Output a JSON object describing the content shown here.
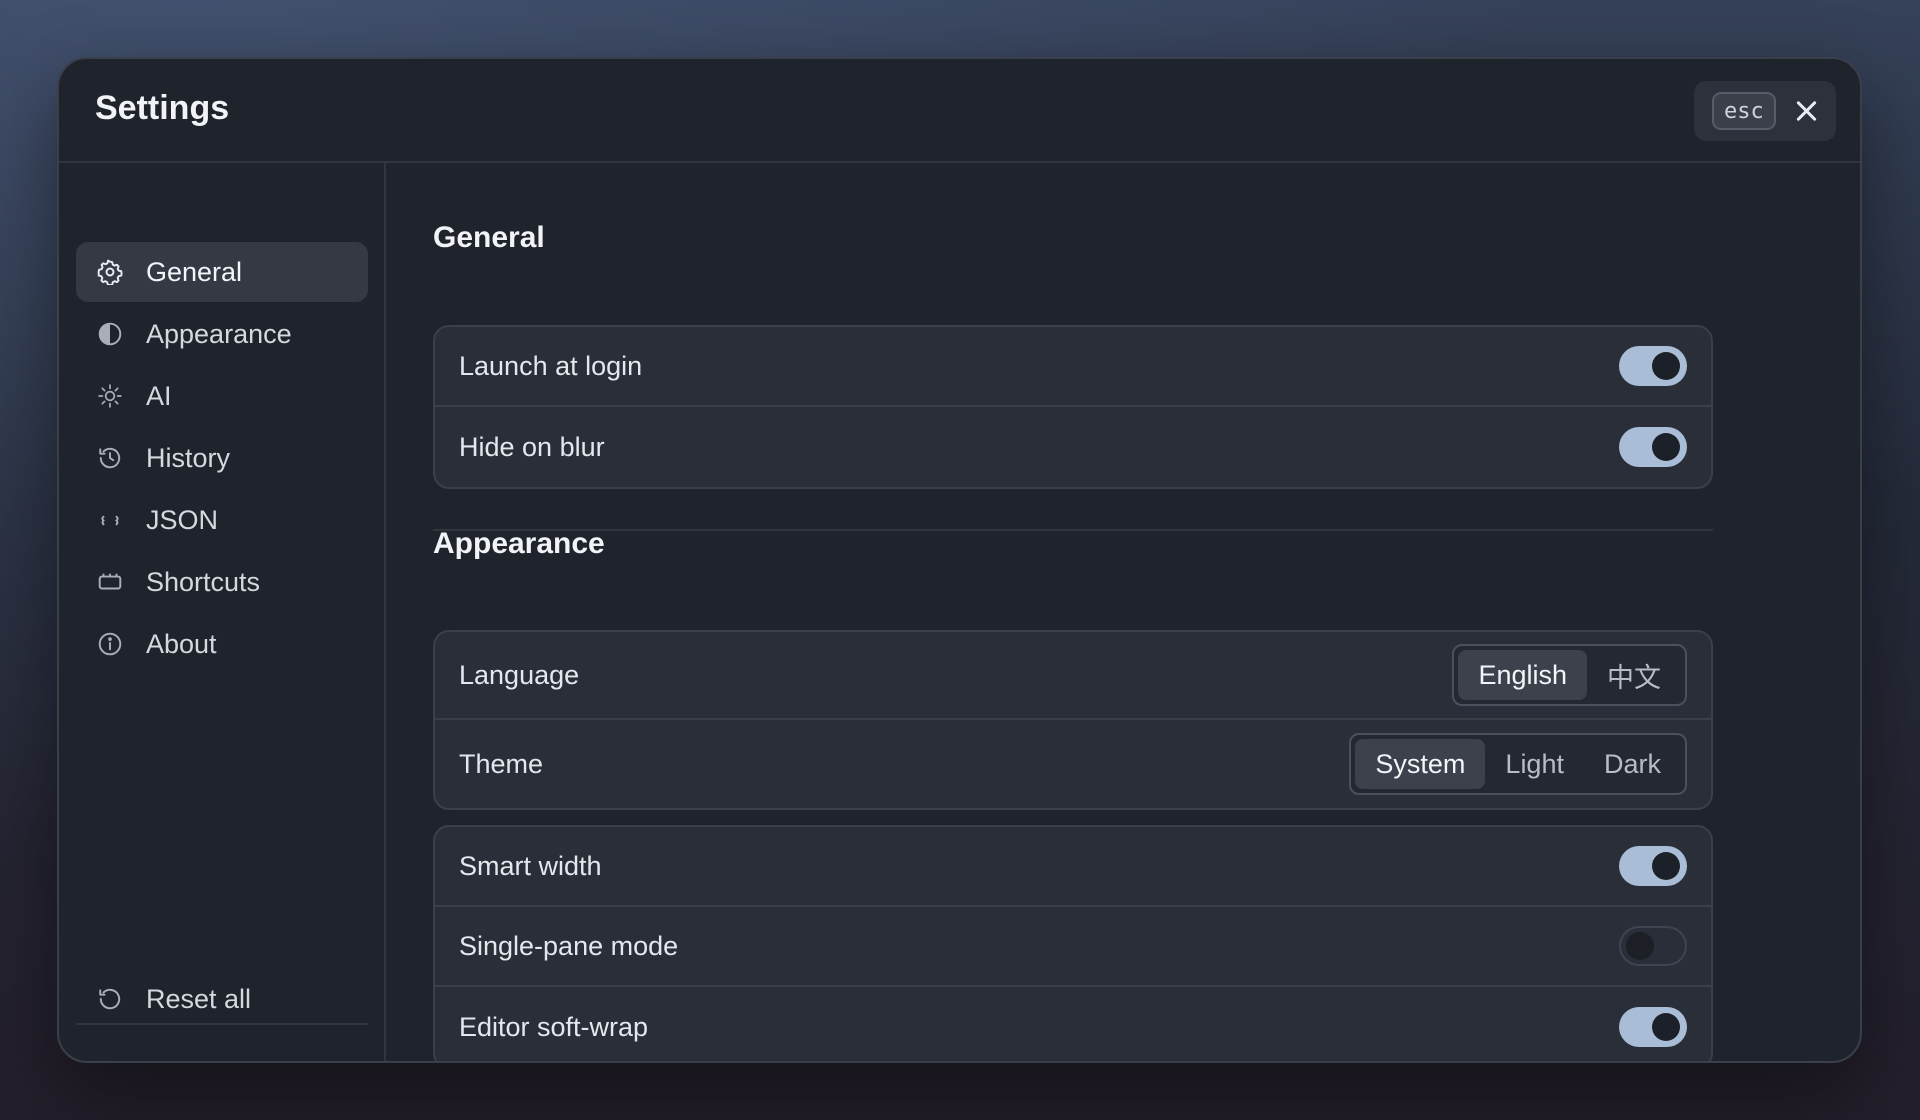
{
  "window": {
    "title": "Settings",
    "esc_label": "esc"
  },
  "sidebar": {
    "items": [
      {
        "label": "General",
        "icon": "gear-icon",
        "active": true
      },
      {
        "label": "Appearance",
        "icon": "half-circle-icon",
        "active": false
      },
      {
        "label": "AI",
        "icon": "sun-icon",
        "active": false
      },
      {
        "label": "History",
        "icon": "history-icon",
        "active": false
      },
      {
        "label": "JSON",
        "icon": "braces-icon",
        "active": false
      },
      {
        "label": "Shortcuts",
        "icon": "keyboard-icon",
        "active": false
      },
      {
        "label": "About",
        "icon": "info-icon",
        "active": false
      }
    ],
    "reset_label": "Reset all"
  },
  "general": {
    "title": "General",
    "rows": [
      {
        "label": "Launch at login",
        "on": true
      },
      {
        "label": "Hide on blur",
        "on": true
      }
    ]
  },
  "appearance": {
    "title": "Appearance",
    "language": {
      "label": "Language",
      "options": [
        "English",
        "中文"
      ],
      "selected": "English"
    },
    "theme": {
      "label": "Theme",
      "options": [
        "System",
        "Light",
        "Dark"
      ],
      "selected": "System"
    },
    "rows": [
      {
        "label": "Smart width",
        "on": true
      },
      {
        "label": "Single-pane mode",
        "on": false
      },
      {
        "label": "Editor soft-wrap",
        "on": true
      }
    ]
  },
  "colors": {
    "toggle_on": "#a9bed6",
    "panel": "#1f232c",
    "card": "#2a2e38"
  }
}
